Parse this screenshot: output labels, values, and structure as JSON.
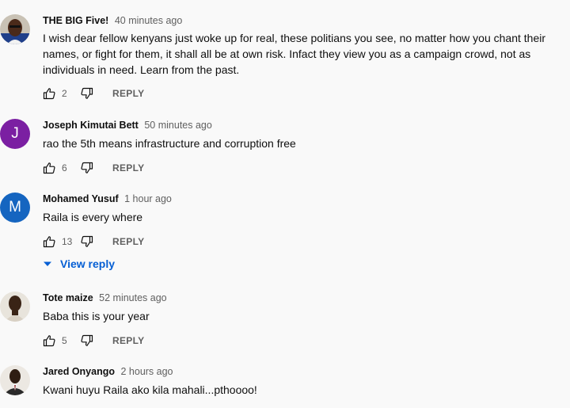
{
  "comments": [
    {
      "author": "THE BIG Five!",
      "time": "40 minutes ago",
      "text": "I wish dear fellow kenyans just woke up for real, these politians you see, no matter how you chant their names, or fight for them, it shall all be at own risk. Infact they view you as a campaign crowd, not as individuals in need. Learn from the past.",
      "likes": "2",
      "reply_label": "REPLY",
      "avatar_type": "photo"
    },
    {
      "author": "Joseph Kimutai Bett",
      "time": "50 minutes ago",
      "text": "rao the 5th means infrastructure and corruption free",
      "likes": "6",
      "reply_label": "REPLY",
      "avatar_type": "letter",
      "avatar_letter": "J",
      "avatar_color": "#7b1fa2"
    },
    {
      "author": "Mohamed Yusuf",
      "time": "1 hour ago",
      "text": "Raila is every where",
      "likes": "13",
      "reply_label": "REPLY",
      "avatar_type": "letter",
      "avatar_letter": "M",
      "avatar_color": "#1565c0"
    },
    {
      "author": "Tote maize",
      "time": "52 minutes ago",
      "text": "Baba this is your year",
      "likes": "5",
      "reply_label": "REPLY",
      "avatar_type": "photo"
    },
    {
      "author": "Jared Onyango",
      "time": "2 hours ago",
      "text": "Kwani huyu Raila ako kila mahali...pthoooo!",
      "avatar_type": "photo"
    }
  ],
  "view_replies_label": "View reply",
  "colors": {
    "background": "#f9f9f9",
    "link_blue": "#065fd4",
    "muted_text": "#606060"
  },
  "icons": {
    "like": "thumbs-up-icon",
    "dislike": "thumbs-down-icon",
    "expand": "caret-down-icon"
  }
}
